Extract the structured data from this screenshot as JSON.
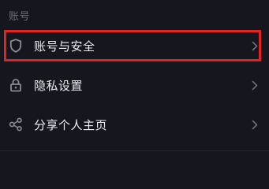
{
  "section": {
    "title": "账号"
  },
  "items": [
    {
      "label": "账号与安全",
      "icon": "shield-icon",
      "highlighted": true
    },
    {
      "label": "隐私设置",
      "icon": "lock-icon",
      "highlighted": false
    },
    {
      "label": "分享个人主页",
      "icon": "share-icon",
      "highlighted": false
    }
  ],
  "colors": {
    "background": "#16161e",
    "highlight": "#e02424",
    "icon": "#8a8a93",
    "text": "#ececf0",
    "section_text": "#6f6f78"
  }
}
